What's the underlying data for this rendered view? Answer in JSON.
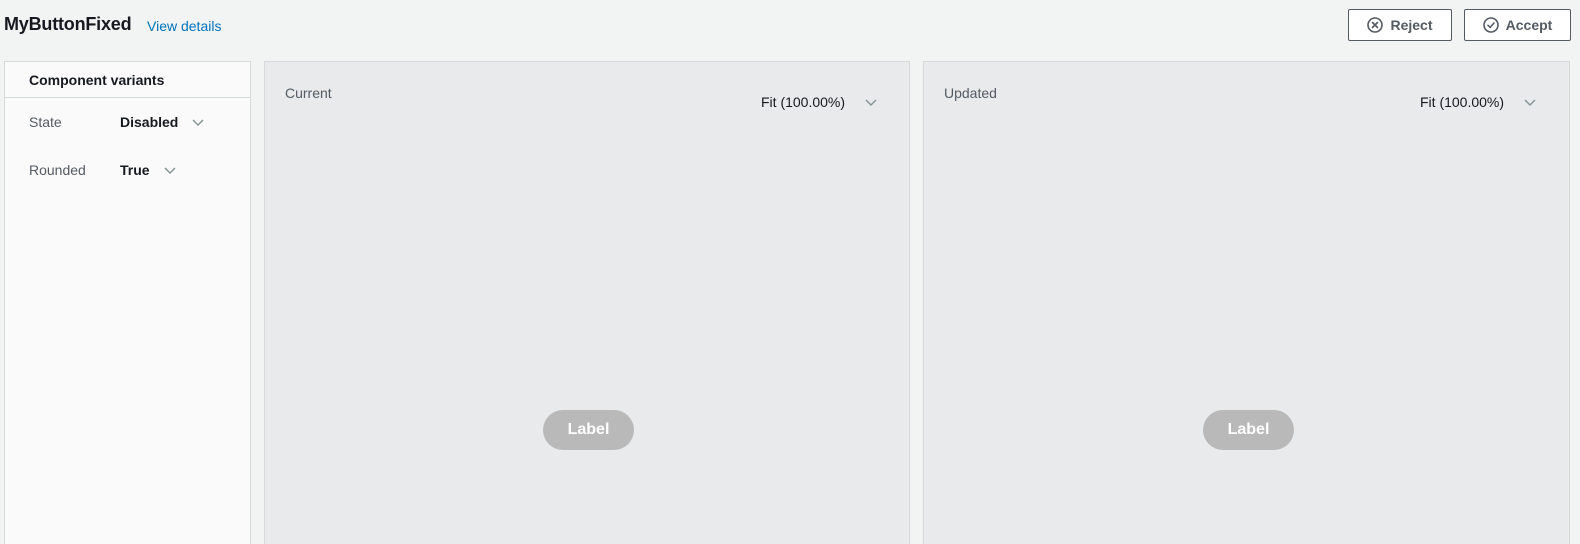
{
  "header": {
    "title": "MyButtonFixed",
    "view_details": "View details",
    "reject_label": "Reject",
    "accept_label": "Accept"
  },
  "sidebar": {
    "heading": "Component variants",
    "variants": [
      {
        "label": "State",
        "value": "Disabled"
      },
      {
        "label": "Rounded",
        "value": "True"
      }
    ]
  },
  "panels": {
    "current": {
      "label": "Current",
      "zoom": "Fit (100.00%)",
      "preview_label": "Label"
    },
    "updated": {
      "label": "Updated",
      "zoom": "Fit (100.00%)",
      "preview_label": "Label"
    }
  },
  "icons": {
    "reject": "circle-x-icon",
    "accept": "circle-check-icon",
    "dropdown": "chevron-down-icon"
  },
  "colors": {
    "link": "#0073bb",
    "background": "#f2f3f3",
    "panel": "#e8eaeb",
    "preview_button": "#b9b9b9"
  }
}
